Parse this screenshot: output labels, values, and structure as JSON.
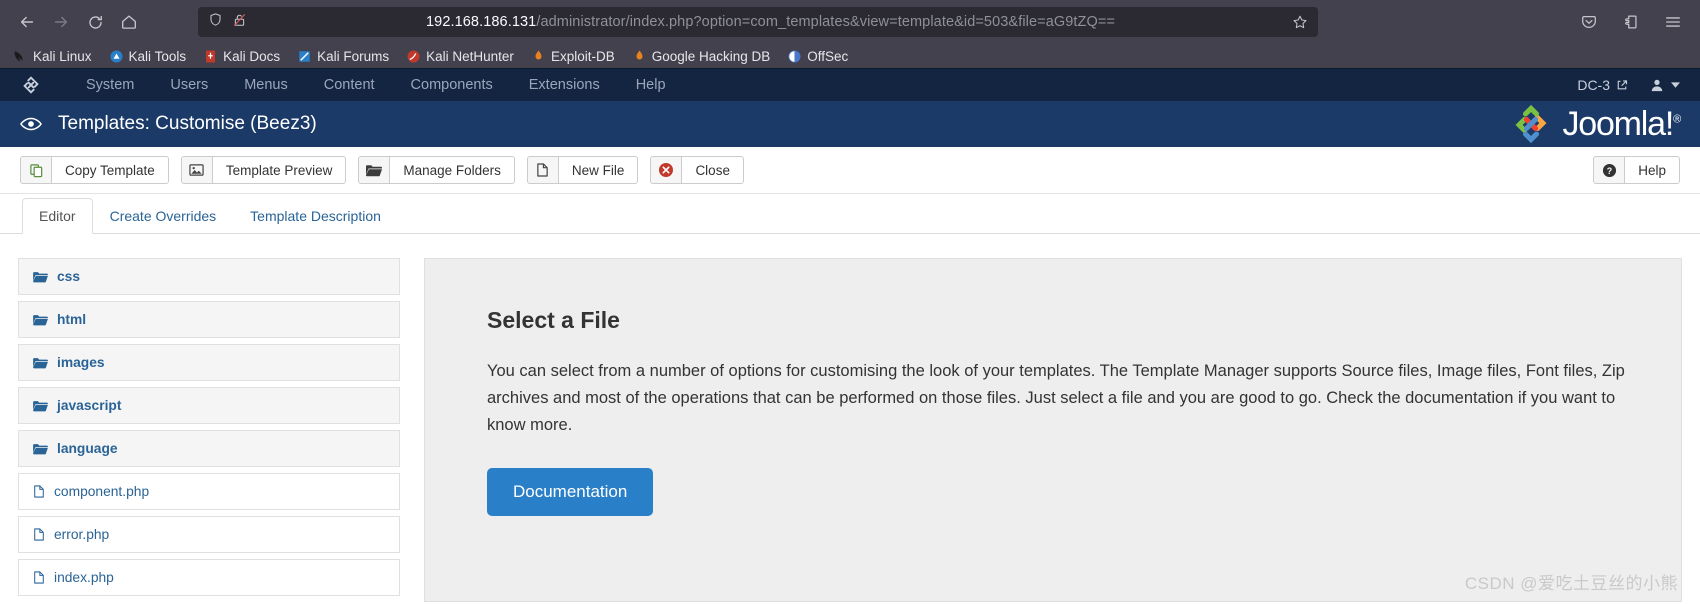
{
  "browser": {
    "nav": {
      "back": "back-arrow",
      "forward": "forward-arrow",
      "reload": "reload",
      "home": "home"
    },
    "url": {
      "host": "192.168.186.131",
      "path": "/administrator/index.php?option=com_templates&view=template&id=503&file=aG9tZQ==",
      "full": "192.168.186.131/administrator/index.php?option=com_templates&view=template&id=503&file=aG9tZQ=="
    },
    "right_icons": [
      "pocket-icon",
      "extensions-icon",
      "menu-icon"
    ],
    "bookmarks": [
      {
        "label": "Kali Linux",
        "color": "#1a1a1a"
      },
      {
        "label": "Kali Tools",
        "color": "#2a7fc9"
      },
      {
        "label": "Kali Docs",
        "color": "#c0392b"
      },
      {
        "label": "Kali Forums",
        "color": "#2a7fc9"
      },
      {
        "label": "Kali NetHunter",
        "color": "#c0392b"
      },
      {
        "label": "Exploit-DB",
        "color": "#e8821e"
      },
      {
        "label": "Google Hacking DB",
        "color": "#e8821e"
      },
      {
        "label": "OffSec",
        "color": "#4a78c8"
      }
    ]
  },
  "admin": {
    "menu": [
      "System",
      "Users",
      "Menus",
      "Content",
      "Components",
      "Extensions",
      "Help"
    ],
    "site_name": "DC-3",
    "brand": "Joomla!",
    "page_title": "Templates: Customise (Beez3)"
  },
  "toolbar": {
    "buttons": [
      {
        "label": "Copy Template",
        "icon": "copy-icon"
      },
      {
        "label": "Template Preview",
        "icon": "image-icon"
      },
      {
        "label": "Manage Folders",
        "icon": "folder-icon"
      },
      {
        "label": "New File",
        "icon": "file-icon"
      },
      {
        "label": "Close",
        "icon": "close-circle-icon"
      }
    ],
    "help": {
      "label": "Help",
      "icon": "question-circle-icon"
    }
  },
  "tabs": [
    {
      "label": "Editor",
      "active": true
    },
    {
      "label": "Create Overrides",
      "active": false
    },
    {
      "label": "Template Description",
      "active": false
    }
  ],
  "files": [
    {
      "name": "css",
      "type": "folder"
    },
    {
      "name": "html",
      "type": "folder"
    },
    {
      "name": "images",
      "type": "folder"
    },
    {
      "name": "javascript",
      "type": "folder"
    },
    {
      "name": "language",
      "type": "folder"
    },
    {
      "name": "component.php",
      "type": "file"
    },
    {
      "name": "error.php",
      "type": "file"
    },
    {
      "name": "index.php",
      "type": "file"
    }
  ],
  "panel": {
    "heading": "Select a File",
    "body": "You can select from a number of options for customising the look of your templates. The Template Manager supports Source files, Image files, Font files, Zip archives and most of the operations that can be performed on those files. Just select a file and you are good to go. Check the documentation if you want to know more.",
    "button": "Documentation"
  },
  "watermark": "CSDN @爱吃土豆丝的小熊",
  "colors": {
    "chrome": "#42414d",
    "urlbar": "#2b2a33",
    "admin_bar": "#142541",
    "page_head": "#1b3a68",
    "link": "#2a6496",
    "primary_button": "#2a7fc9"
  }
}
